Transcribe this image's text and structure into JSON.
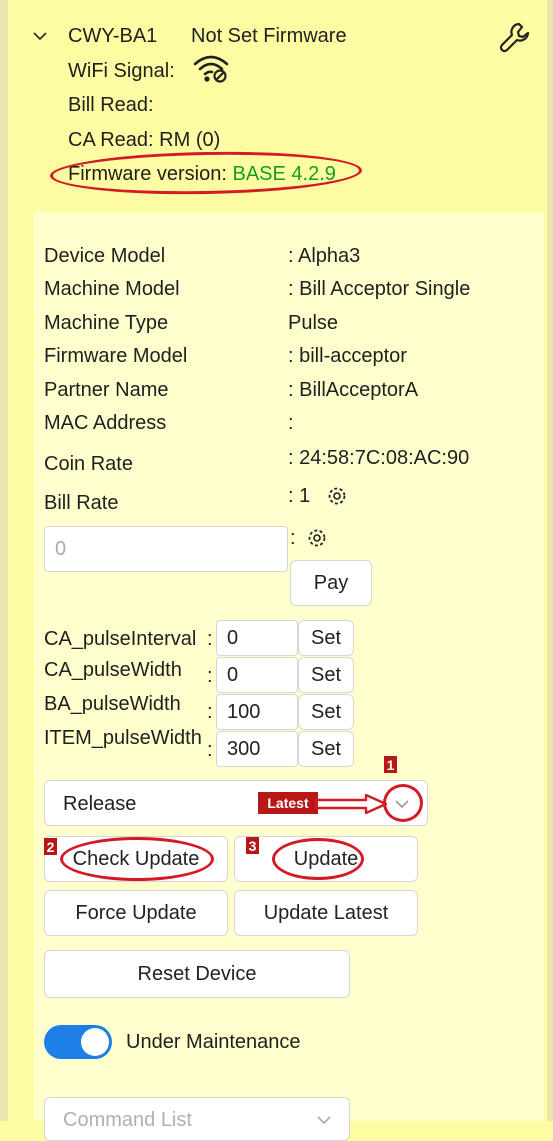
{
  "device": {
    "name": "CWY-BA1",
    "firmware_status": "Not Set Firmware",
    "wifi_label": "WiFi Signal:",
    "bill_read": "Bill Read:",
    "ca_read": "CA Read: RM (0)",
    "firmware_version_label": "Firmware version:",
    "firmware_version_value": "BASE 4.2.9"
  },
  "details": [
    {
      "label": "Device Model",
      "value": ": Alpha3"
    },
    {
      "label": "Machine Model",
      "value": ": Bill Acceptor Single"
    },
    {
      "label": "Machine Type",
      "value": "Pulse"
    },
    {
      "label": "Firmware Model",
      "value": ": bill-acceptor"
    },
    {
      "label": "Partner Name",
      "value": ": BillAcceptorA"
    },
    {
      "label": "MAC Address",
      "value": ":"
    },
    {
      "label": "Coin Rate",
      "value": ": 24:58:7C:08:AC:90"
    },
    {
      "label": "Bill Rate",
      "value": ": 1"
    }
  ],
  "pay": {
    "placeholder": "0",
    "colon": ":",
    "button": "Pay"
  },
  "pulses": [
    {
      "label": "CA_pulseInterval",
      "colon": ":",
      "value": "0",
      "button": "Set"
    },
    {
      "label": "CA_pulseWidth",
      "colon": ":",
      "value": "0",
      "button": "Set"
    },
    {
      "label": "BA_pulseWidth",
      "colon": ":",
      "value": "100",
      "button": "Set"
    },
    {
      "label": "ITEM_pulseWidth",
      "colon": ":",
      "value": "300",
      "button": "Set"
    }
  ],
  "release": {
    "selected": "Release",
    "annotation": "Latest"
  },
  "buttons": {
    "check_update": "Check Update",
    "update": "Update",
    "force_update": "Force Update",
    "update_latest": "Update Latest",
    "reset_device": "Reset Device"
  },
  "maintenance": {
    "label": "Under Maintenance",
    "enabled": true
  },
  "command_list": {
    "placeholder": "Command List"
  },
  "markers": [
    "1",
    "2",
    "3"
  ],
  "colors": {
    "background": "#fdfca2",
    "panel": "#ffffce",
    "accent": "#1e7fe6",
    "annotation": "#d41a24",
    "version": "#159d1d"
  }
}
